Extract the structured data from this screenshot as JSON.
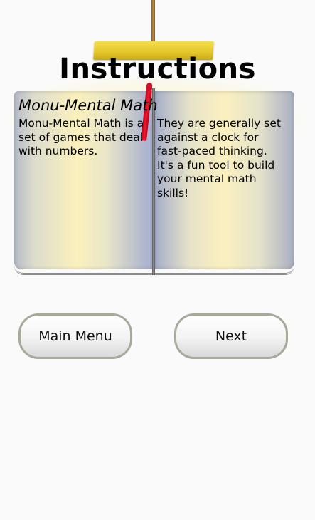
{
  "header": {
    "title": "Instructions"
  },
  "book": {
    "heading": "Monu-Mental Math",
    "left_text": "Monu-Mental Math is a set of games that deal with numbers.",
    "right_text": "They are generally set against a clock for fast-paced thinking. It's a fun tool to build your mental math skills!"
  },
  "buttons": {
    "main_menu": "Main Menu",
    "next": "Next"
  },
  "colors": {
    "background": "#fafafa",
    "sign_board": "#e6c82c",
    "bookmark_ribbon": "#d0102a",
    "button_border": "#a9a89a"
  }
}
